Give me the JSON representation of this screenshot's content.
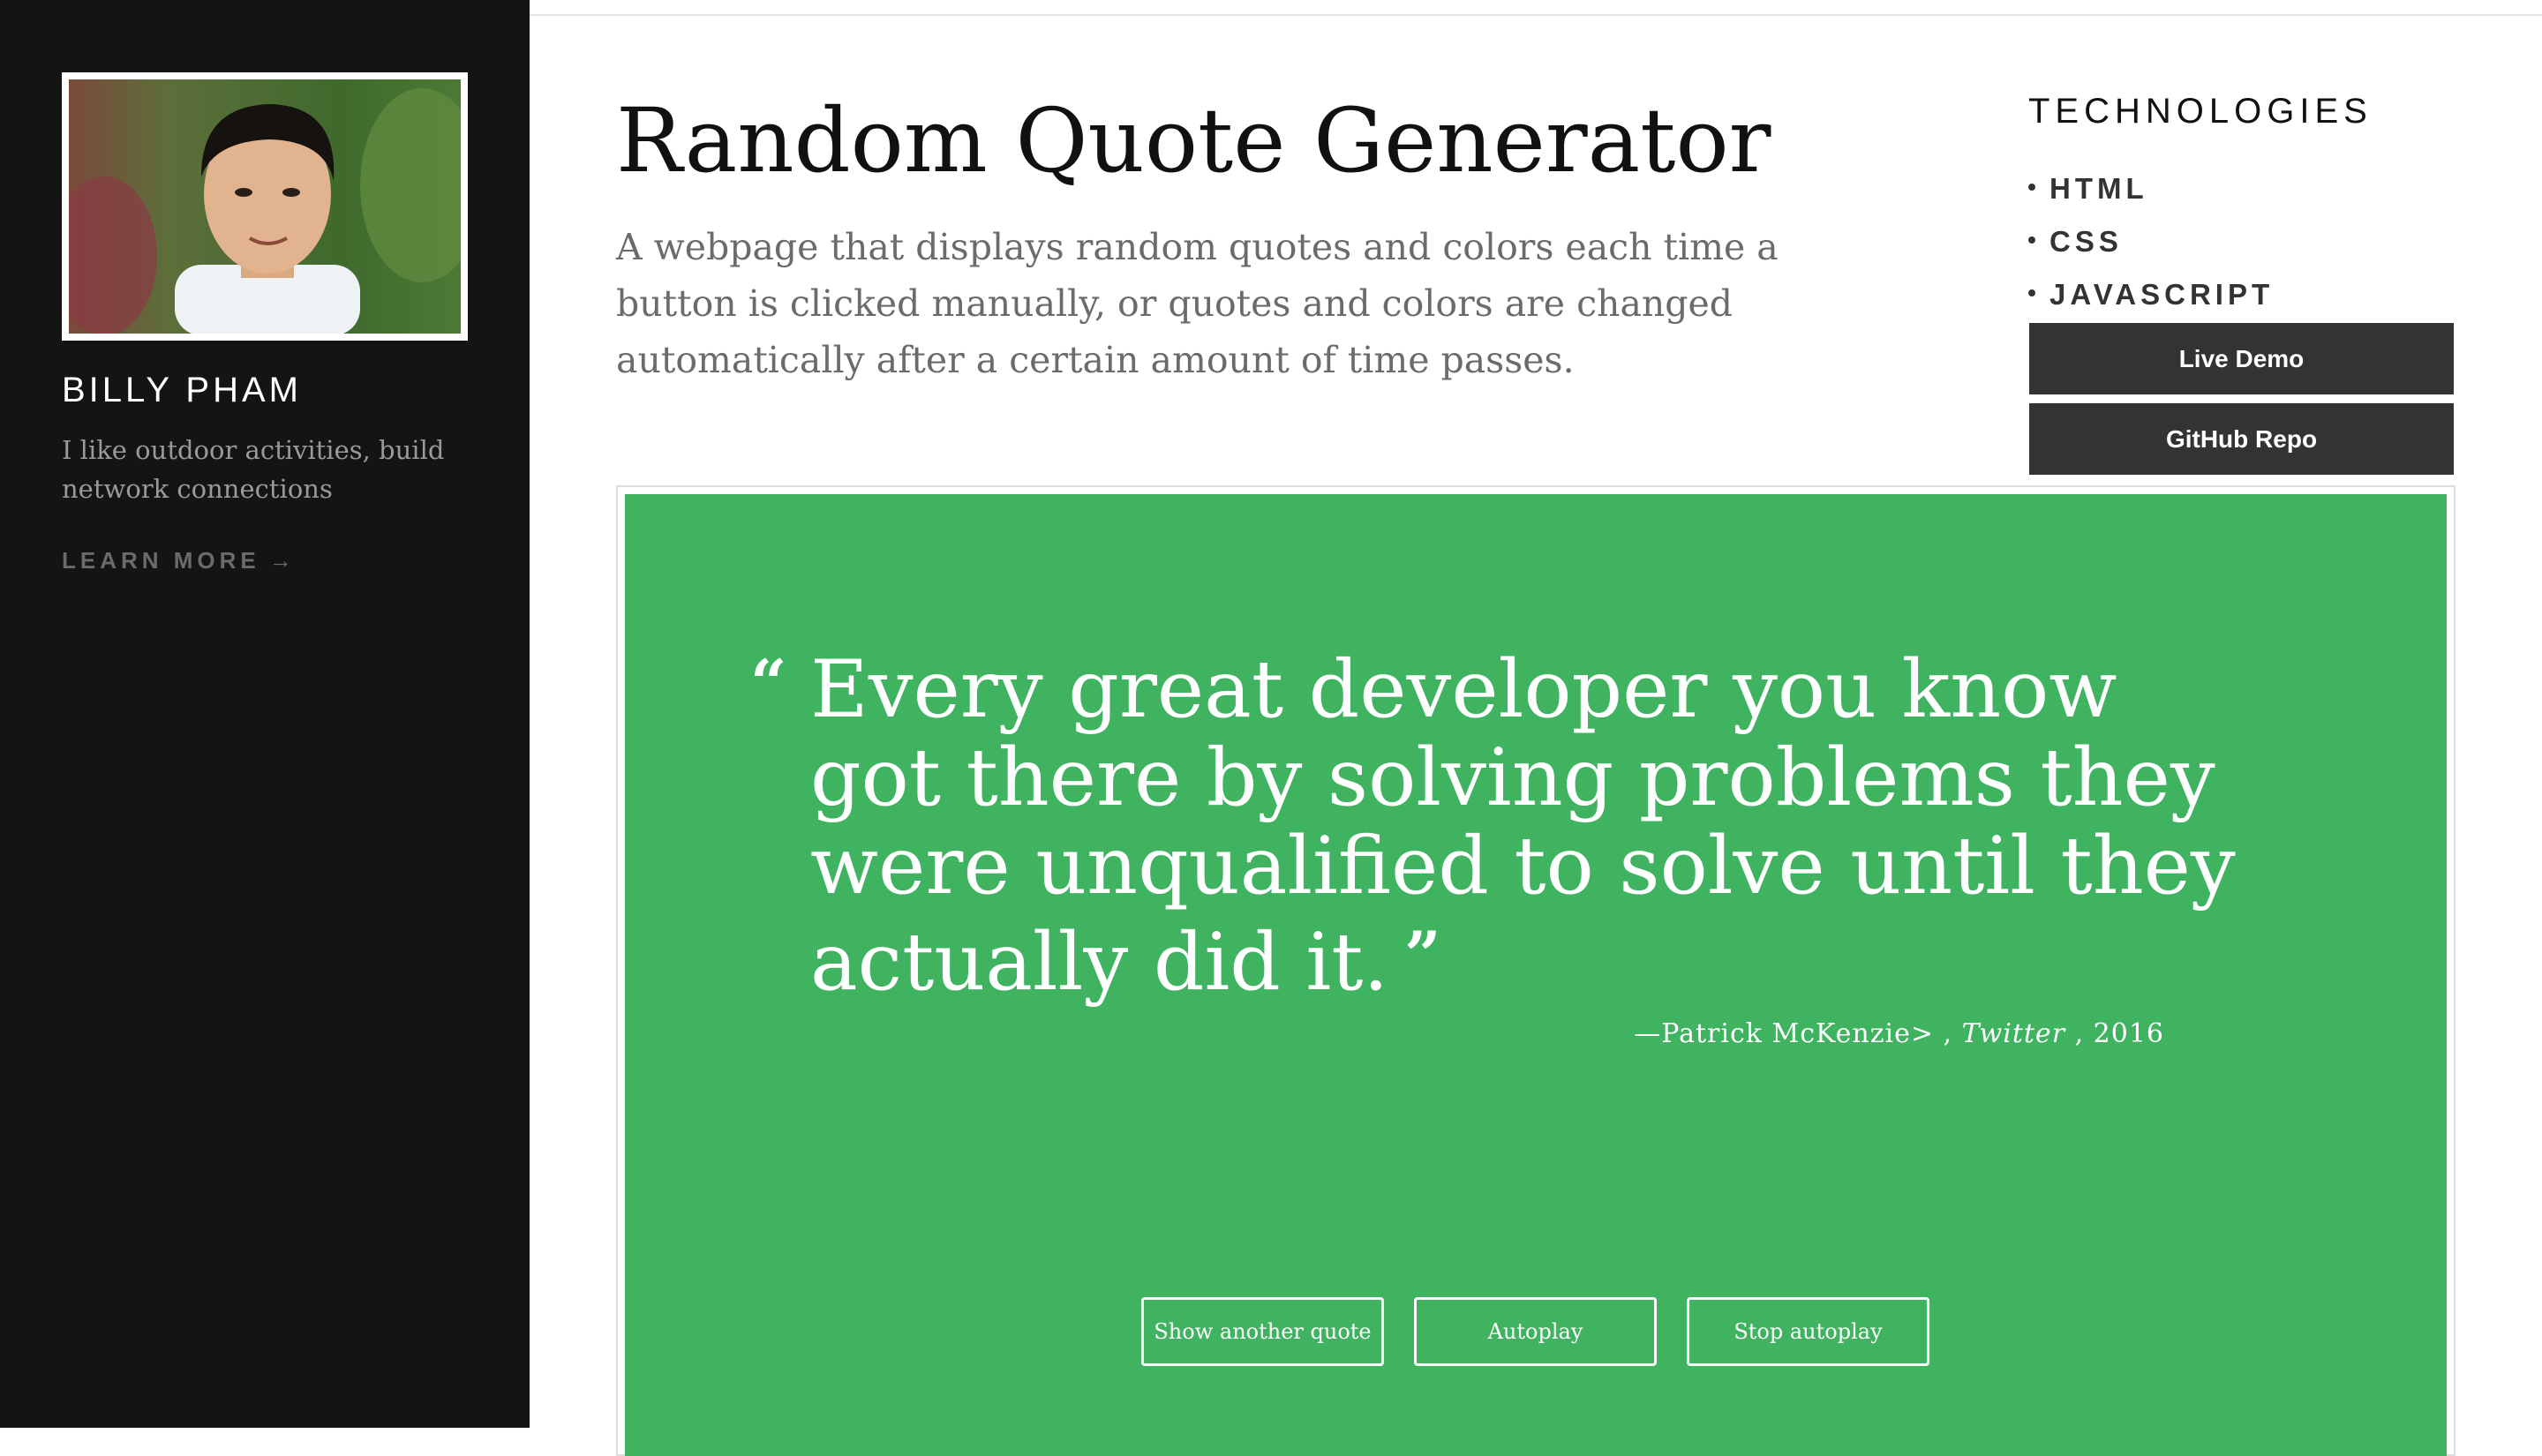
{
  "sidebar": {
    "name": "BILLY PHAM",
    "bio": "I like outdoor activities, build network connections",
    "learn_more": "LEARN MORE",
    "learn_more_arrow": "→"
  },
  "header": {
    "title": "Random Quote Generator",
    "description": "A webpage that displays random quotes and colors each time a button is clicked manually, or quotes and colors are changed automatically after a certain amount of time passes."
  },
  "technologies": {
    "heading": "TECHNOLOGIES",
    "items": [
      "HTML",
      "CSS",
      "JAVASCRIPT"
    ],
    "live_demo": "Live Demo",
    "github_repo": "GitHub Repo"
  },
  "quote": {
    "open_mark": "“",
    "text": "Every great developer you know got there by solving problems they were unqualified to solve until they actually did it.",
    "close_mark": "”",
    "attribution_prefix": "—Patrick McKenzie> ,",
    "source": "Twitter",
    "year": ", 2016",
    "background_color": "#3fb35f",
    "buttons": {
      "next": "Show another quote",
      "autoplay": "Autoplay",
      "stop": "Stop autoplay"
    }
  },
  "icons": {
    "avatar": "person-portrait",
    "arrow": "arrow-right-icon"
  }
}
